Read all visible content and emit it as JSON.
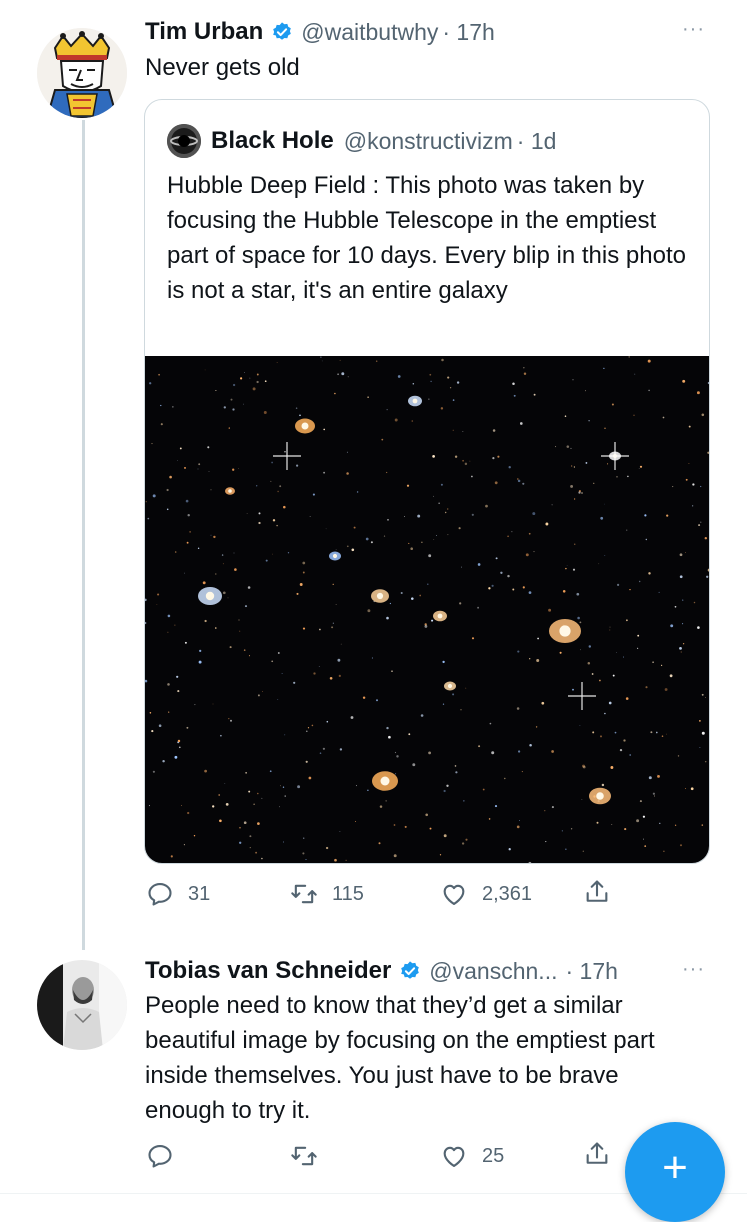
{
  "tweet": {
    "author_name": "Tim Urban",
    "author_handle": "@waitbutwhy",
    "time": "· 17h",
    "text": "Never gets old",
    "more_label": "···",
    "quote": {
      "author_name": "Black Hole",
      "author_handle": "@konstructivizm",
      "time": "· 1d",
      "text": "Hubble Deep Field : This photo was taken by focusing the Hubble Telescope in the emptiest part of space for 10 days. Every blip in this photo is not a star, it's an entire galaxy"
    },
    "actions": {
      "replies": "31",
      "retweets": "115",
      "likes": "2,361"
    }
  },
  "reply": {
    "author_name": "Tobias van Schneider",
    "author_handle": "@vanschn...",
    "time": "· 17h",
    "text": "People need to know that they’d get a similar beautiful image by focusing on the emptiest part inside themselves. You just have to be brave enough to try it.",
    "more_label": "···",
    "actions": {
      "replies": "",
      "retweets": "",
      "likes": "25"
    }
  },
  "fab": {
    "label": "+"
  },
  "colors": {
    "accent": "#1d9bf0",
    "verified": "#1d9bf0",
    "muted_text": "#536471",
    "border": "#cfd9de"
  },
  "icons": [
    "king-card-avatar-icon",
    "verified-badge-icon",
    "reply-icon",
    "retweet-icon",
    "like-icon",
    "share-icon",
    "compose-icon"
  ]
}
